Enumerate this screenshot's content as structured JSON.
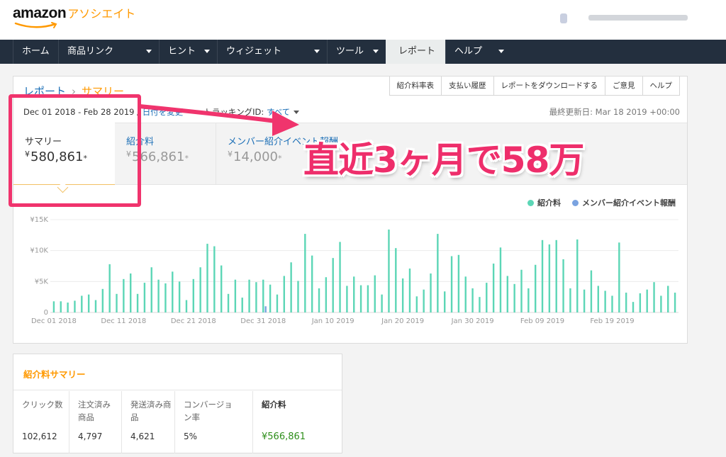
{
  "header": {
    "logo_text": "amazon",
    "logo_sub": "アソシエイト"
  },
  "nav": {
    "items": [
      {
        "label": "ホーム",
        "dropdown": false
      },
      {
        "label": "商品リンク",
        "dropdown": true
      },
      {
        "label": "ヒント",
        "dropdown": true
      },
      {
        "label": "ウィジェット",
        "dropdown": true
      },
      {
        "label": "ツール",
        "dropdown": true
      },
      {
        "label": "レポート",
        "dropdown": false,
        "active": true
      },
      {
        "label": "ヘルプ",
        "dropdown": true
      }
    ]
  },
  "report": {
    "breadcrumb": {
      "root": "レポート",
      "sep": "›",
      "current": "サマリー"
    },
    "buttons": [
      "紹介料率表",
      "支払い履歴",
      "レポートをダウンロードする",
      "ご意見",
      "ヘルプ"
    ],
    "date_range": "Dec 01 2018 - Feb 28 2019 /",
    "date_change": "日付を変更",
    "tracking_label": "トラッキングID:",
    "tracking_value": "すべて",
    "last_updated": "最終更新日: Mar 18 2019 +00:00",
    "tabs": [
      {
        "label": "サマリー",
        "yen": "¥",
        "value": "580,861",
        "suffix": "*"
      },
      {
        "label": "紹介料",
        "yen": "¥",
        "value": "566,861",
        "suffix": "*"
      },
      {
        "label": "メンバー紹介イベント報酬",
        "yen": "¥",
        "value": "14,000",
        "suffix": "*"
      }
    ],
    "legend": [
      {
        "label": "紹介料",
        "color": "#5cd6b6"
      },
      {
        "label": "メンバー紹介イベント報酬",
        "color": "#7aa3e0"
      }
    ]
  },
  "annotation": {
    "callout": "直近3ヶ月で58万",
    "highlight_color": "#f0346d"
  },
  "chart_data": {
    "type": "bar",
    "ylim": [
      0,
      15000
    ],
    "y_ticks": [
      "0",
      "¥5K",
      "¥10K",
      "¥15K"
    ],
    "y_tick_values": [
      0,
      5000,
      10000,
      15000
    ],
    "x_ticks": [
      "Dec 01 2018",
      "Dec 11 2018",
      "Dec 21 2018",
      "Dec 31 2018",
      "Jan 10 2019",
      "Jan 20 2019",
      "Jan 30 2019",
      "Feb 09 2019",
      "Feb 19 2019"
    ],
    "x_tick_dates": [
      "2018-12-01",
      "2018-12-11",
      "2018-12-21",
      "2018-12-31",
      "2019-01-10",
      "2019-01-20",
      "2019-01-30",
      "2019-02-09",
      "2019-02-19"
    ],
    "x": [
      "2018-12-01",
      "2018-12-02",
      "2018-12-03",
      "2018-12-04",
      "2018-12-05",
      "2018-12-06",
      "2018-12-07",
      "2018-12-08",
      "2018-12-09",
      "2018-12-10",
      "2018-12-11",
      "2018-12-12",
      "2018-12-13",
      "2018-12-14",
      "2018-12-15",
      "2018-12-16",
      "2018-12-17",
      "2018-12-18",
      "2018-12-19",
      "2018-12-20",
      "2018-12-21",
      "2018-12-22",
      "2018-12-23",
      "2018-12-24",
      "2018-12-25",
      "2018-12-26",
      "2018-12-27",
      "2018-12-28",
      "2018-12-29",
      "2018-12-30",
      "2018-12-31",
      "2019-01-01",
      "2019-01-02",
      "2019-01-03",
      "2019-01-04",
      "2019-01-05",
      "2019-01-06",
      "2019-01-07",
      "2019-01-08",
      "2019-01-09",
      "2019-01-10",
      "2019-01-11",
      "2019-01-12",
      "2019-01-13",
      "2019-01-14",
      "2019-01-15",
      "2019-01-16",
      "2019-01-17",
      "2019-01-18",
      "2019-01-19",
      "2019-01-20",
      "2019-01-21",
      "2019-01-22",
      "2019-01-23",
      "2019-01-24",
      "2019-01-25",
      "2019-01-26",
      "2019-01-27",
      "2019-01-28",
      "2019-01-29",
      "2019-01-30",
      "2019-01-31",
      "2019-02-01",
      "2019-02-02",
      "2019-02-03",
      "2019-02-04",
      "2019-02-05",
      "2019-02-06",
      "2019-02-07",
      "2019-02-08",
      "2019-02-09",
      "2019-02-10",
      "2019-02-11",
      "2019-02-12",
      "2019-02-13",
      "2019-02-14",
      "2019-02-15",
      "2019-02-16",
      "2019-02-17",
      "2019-02-18",
      "2019-02-19",
      "2019-02-20",
      "2019-02-21",
      "2019-02-22",
      "2019-02-23",
      "2019-02-24",
      "2019-02-25",
      "2019-02-26",
      "2019-02-27",
      "2019-02-28"
    ],
    "series": [
      {
        "name": "紹介料",
        "color": "#5cd6b6",
        "values": [
          1800,
          1800,
          1600,
          1900,
          2700,
          2900,
          2000,
          3800,
          7800,
          3000,
          5400,
          6300,
          3000,
          4800,
          7300,
          5300,
          4700,
          6600,
          5000,
          2000,
          5400,
          7300,
          11100,
          10700,
          7600,
          3000,
          5300,
          2400,
          5300,
          4900,
          5300,
          4500,
          2900,
          5900,
          8100,
          5100,
          12700,
          9200,
          3900,
          5700,
          8800,
          11400,
          4300,
          5800,
          4400,
          4400,
          6000,
          2900,
          13400,
          10400,
          5500,
          7100,
          2600,
          3700,
          6300,
          12700,
          3400,
          9100,
          9300,
          5800,
          3900,
          2500,
          4800,
          7900,
          10500,
          5900,
          4600,
          6900,
          3900,
          7700,
          11700,
          11000,
          11700,
          8600,
          3900,
          11800,
          3700,
          6800,
          4300,
          3500,
          2700,
          11300,
          3200,
          1700,
          3100,
          3700,
          4900,
          2700,
          4300,
          3200
        ]
      },
      {
        "name": "メンバー紹介イベント報酬",
        "color": "#7aa3e0",
        "values": [
          0,
          0,
          0,
          0,
          0,
          0,
          0,
          0,
          0,
          0,
          0,
          0,
          0,
          0,
          0,
          0,
          0,
          0,
          0,
          0,
          0,
          0,
          0,
          0,
          0,
          0,
          0,
          0,
          0,
          0,
          1000,
          0,
          0,
          0,
          0,
          0,
          0,
          0,
          0,
          0,
          0,
          0,
          0,
          0,
          0,
          0,
          0,
          0,
          0,
          0,
          0,
          0,
          0,
          0,
          0,
          0,
          0,
          0,
          0,
          0,
          0,
          0,
          0,
          0,
          0,
          0,
          0,
          0,
          0,
          0,
          0,
          0,
          0,
          0,
          0,
          0,
          0,
          0,
          0,
          0,
          0,
          0,
          0,
          0,
          0,
          0,
          0,
          0,
          0,
          0
        ]
      }
    ]
  },
  "summary": {
    "title": "紹介料サマリー",
    "columns": [
      {
        "header": "クリック数",
        "value": "102,612"
      },
      {
        "header": "注文済み商品",
        "value": "4,797"
      },
      {
        "header": "発送済み商品",
        "value": "4,621"
      },
      {
        "header": "コンバージョン率",
        "value": "5%"
      },
      {
        "header": "紹介料",
        "value": "¥566,861"
      }
    ]
  }
}
